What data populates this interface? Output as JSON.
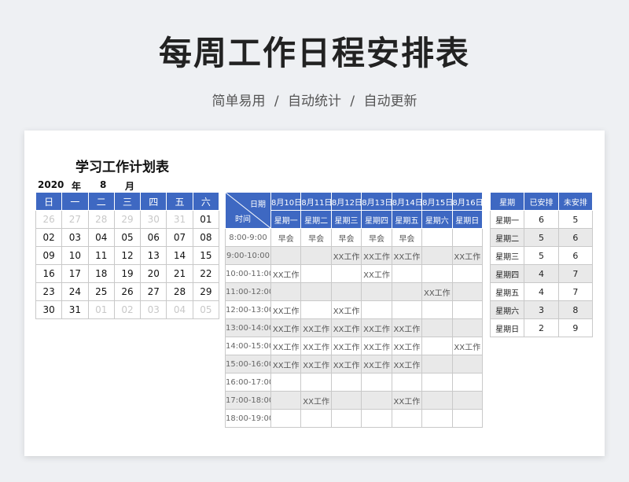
{
  "header": {
    "title": "每周工作日程安排表",
    "subtitle": "简单易用 / 自动统计 / 自动更新"
  },
  "sheet": {
    "title": "学习工作计划表",
    "year": "2020",
    "year_label": "年",
    "month": "8",
    "month_label": "月"
  },
  "calendar": {
    "weekdays": [
      "日",
      "一",
      "二",
      "三",
      "四",
      "五",
      "六"
    ],
    "weeks": [
      [
        {
          "d": "26",
          "dim": true
        },
        {
          "d": "27",
          "dim": true
        },
        {
          "d": "28",
          "dim": true
        },
        {
          "d": "29",
          "dim": true
        },
        {
          "d": "30",
          "dim": true
        },
        {
          "d": "31",
          "dim": true
        },
        {
          "d": "01",
          "dim": false
        }
      ],
      [
        {
          "d": "02",
          "dim": false
        },
        {
          "d": "03",
          "dim": false
        },
        {
          "d": "04",
          "dim": false
        },
        {
          "d": "05",
          "dim": false
        },
        {
          "d": "06",
          "dim": false
        },
        {
          "d": "07",
          "dim": false
        },
        {
          "d": "08",
          "dim": false
        }
      ],
      [
        {
          "d": "09",
          "dim": false
        },
        {
          "d": "10",
          "dim": false
        },
        {
          "d": "11",
          "dim": false
        },
        {
          "d": "12",
          "dim": false
        },
        {
          "d": "13",
          "dim": false
        },
        {
          "d": "14",
          "dim": false
        },
        {
          "d": "15",
          "dim": false
        }
      ],
      [
        {
          "d": "16",
          "dim": false
        },
        {
          "d": "17",
          "dim": false
        },
        {
          "d": "18",
          "dim": false
        },
        {
          "d": "19",
          "dim": false
        },
        {
          "d": "20",
          "dim": false
        },
        {
          "d": "21",
          "dim": false
        },
        {
          "d": "22",
          "dim": false
        }
      ],
      [
        {
          "d": "23",
          "dim": false
        },
        {
          "d": "24",
          "dim": false
        },
        {
          "d": "25",
          "dim": false
        },
        {
          "d": "26",
          "dim": false
        },
        {
          "d": "27",
          "dim": false
        },
        {
          "d": "28",
          "dim": false
        },
        {
          "d": "29",
          "dim": false
        }
      ],
      [
        {
          "d": "30",
          "dim": false
        },
        {
          "d": "31",
          "dim": false
        },
        {
          "d": "01",
          "dim": true
        },
        {
          "d": "02",
          "dim": true
        },
        {
          "d": "03",
          "dim": true
        },
        {
          "d": "04",
          "dim": true
        },
        {
          "d": "05",
          "dim": true
        }
      ]
    ]
  },
  "schedule": {
    "corner_top": "日期",
    "corner_bottom": "时间",
    "dates": [
      "8月10日",
      "8月11日",
      "8月12日",
      "8月13日",
      "8月14日",
      "8月15日",
      "8月16日"
    ],
    "weekdays": [
      "星期一",
      "星期二",
      "星期三",
      "星期四",
      "星期五",
      "星期六",
      "星期日"
    ],
    "rows": [
      {
        "time": "8:00-9:00",
        "cells": [
          "早会",
          "早会",
          "早会",
          "早会",
          "早会",
          "",
          ""
        ]
      },
      {
        "time": "9:00-10:00",
        "cells": [
          "",
          "",
          "XX工作",
          "XX工作",
          "XX工作",
          "",
          "XX工作"
        ]
      },
      {
        "time": "10:00-11:00",
        "cells": [
          "XX工作",
          "",
          "",
          "XX工作",
          "",
          "",
          ""
        ]
      },
      {
        "time": "11:00-12:00",
        "cells": [
          "",
          "",
          "",
          "",
          "",
          "XX工作",
          ""
        ]
      },
      {
        "time": "12:00-13:00",
        "cells": [
          "XX工作",
          "",
          "XX工作",
          "",
          "",
          "",
          ""
        ]
      },
      {
        "time": "13:00-14:00",
        "cells": [
          "XX工作",
          "XX工作",
          "XX工作",
          "XX工作",
          "XX工作",
          "",
          ""
        ]
      },
      {
        "time": "14:00-15:00",
        "cells": [
          "XX工作",
          "XX工作",
          "XX工作",
          "XX工作",
          "XX工作",
          "",
          "XX工作"
        ]
      },
      {
        "time": "15:00-16:00",
        "cells": [
          "XX工作",
          "XX工作",
          "XX工作",
          "XX工作",
          "XX工作",
          "",
          ""
        ]
      },
      {
        "time": "16:00-17:00",
        "cells": [
          "",
          "",
          "",
          "",
          "",
          "",
          ""
        ]
      },
      {
        "time": "17:00-18:00",
        "cells": [
          "",
          "XX工作",
          "",
          "",
          "XX工作",
          "",
          ""
        ]
      },
      {
        "time": "18:00-19:00",
        "cells": [
          "",
          "",
          "",
          "",
          "",
          "",
          ""
        ]
      }
    ]
  },
  "summary": {
    "headers": [
      "星期",
      "已安排",
      "未安排"
    ],
    "rows": [
      {
        "day": "星期一",
        "done": "6",
        "todo": "5"
      },
      {
        "day": "星期二",
        "done": "5",
        "todo": "6"
      },
      {
        "day": "星期三",
        "done": "5",
        "todo": "6"
      },
      {
        "day": "星期四",
        "done": "4",
        "todo": "7"
      },
      {
        "day": "星期五",
        "done": "4",
        "todo": "7"
      },
      {
        "day": "星期六",
        "done": "3",
        "todo": "8"
      },
      {
        "day": "星期日",
        "done": "2",
        "todo": "9"
      }
    ]
  },
  "colors": {
    "header_blue": "#3e68c2",
    "alt_row": "#e9e9e9",
    "dim_text": "#c8c8c8"
  }
}
